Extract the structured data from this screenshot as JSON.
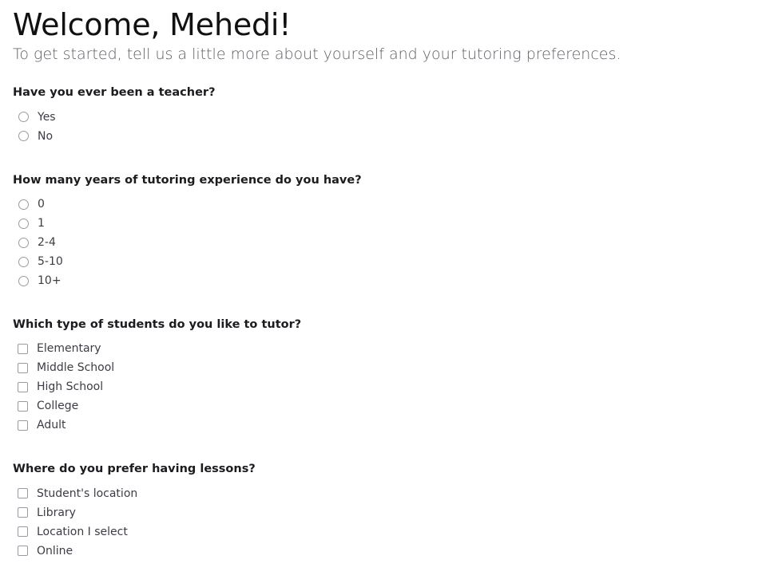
{
  "header": {
    "title": "Welcome, Mehedi!",
    "subtitle": "To get started, tell us a little more about yourself and your tutoring preferences."
  },
  "colors": {
    "title_text": "#111111",
    "subtitle_text": "#5e5e66",
    "question_text": "#1c1c20",
    "option_text": "#3c3c44",
    "control_border": "#9a9aa2",
    "background": "#ffffff"
  },
  "questions": [
    {
      "title": "Have you ever been a teacher?",
      "input_type": "radio",
      "options": [
        {
          "label": "Yes",
          "checked": false
        },
        {
          "label": "No",
          "checked": false
        }
      ]
    },
    {
      "title": "How many years of tutoring experience do you have?",
      "input_type": "radio",
      "options": [
        {
          "label": "0",
          "checked": false
        },
        {
          "label": "1",
          "checked": false
        },
        {
          "label": "2-4",
          "checked": false
        },
        {
          "label": "5-10",
          "checked": false
        },
        {
          "label": "10+",
          "checked": false
        }
      ]
    },
    {
      "title": "Which type of students do you like to tutor?",
      "input_type": "checkbox",
      "options": [
        {
          "label": "Elementary",
          "checked": false
        },
        {
          "label": "Middle School",
          "checked": false
        },
        {
          "label": "High School",
          "checked": false
        },
        {
          "label": "College",
          "checked": false
        },
        {
          "label": "Adult",
          "checked": false
        }
      ]
    },
    {
      "title": "Where do you prefer having lessons?",
      "input_type": "checkbox",
      "options": [
        {
          "label": "Student's location",
          "checked": false
        },
        {
          "label": "Library",
          "checked": false
        },
        {
          "label": "Location I select",
          "checked": false
        },
        {
          "label": "Online",
          "checked": false
        }
      ]
    }
  ]
}
